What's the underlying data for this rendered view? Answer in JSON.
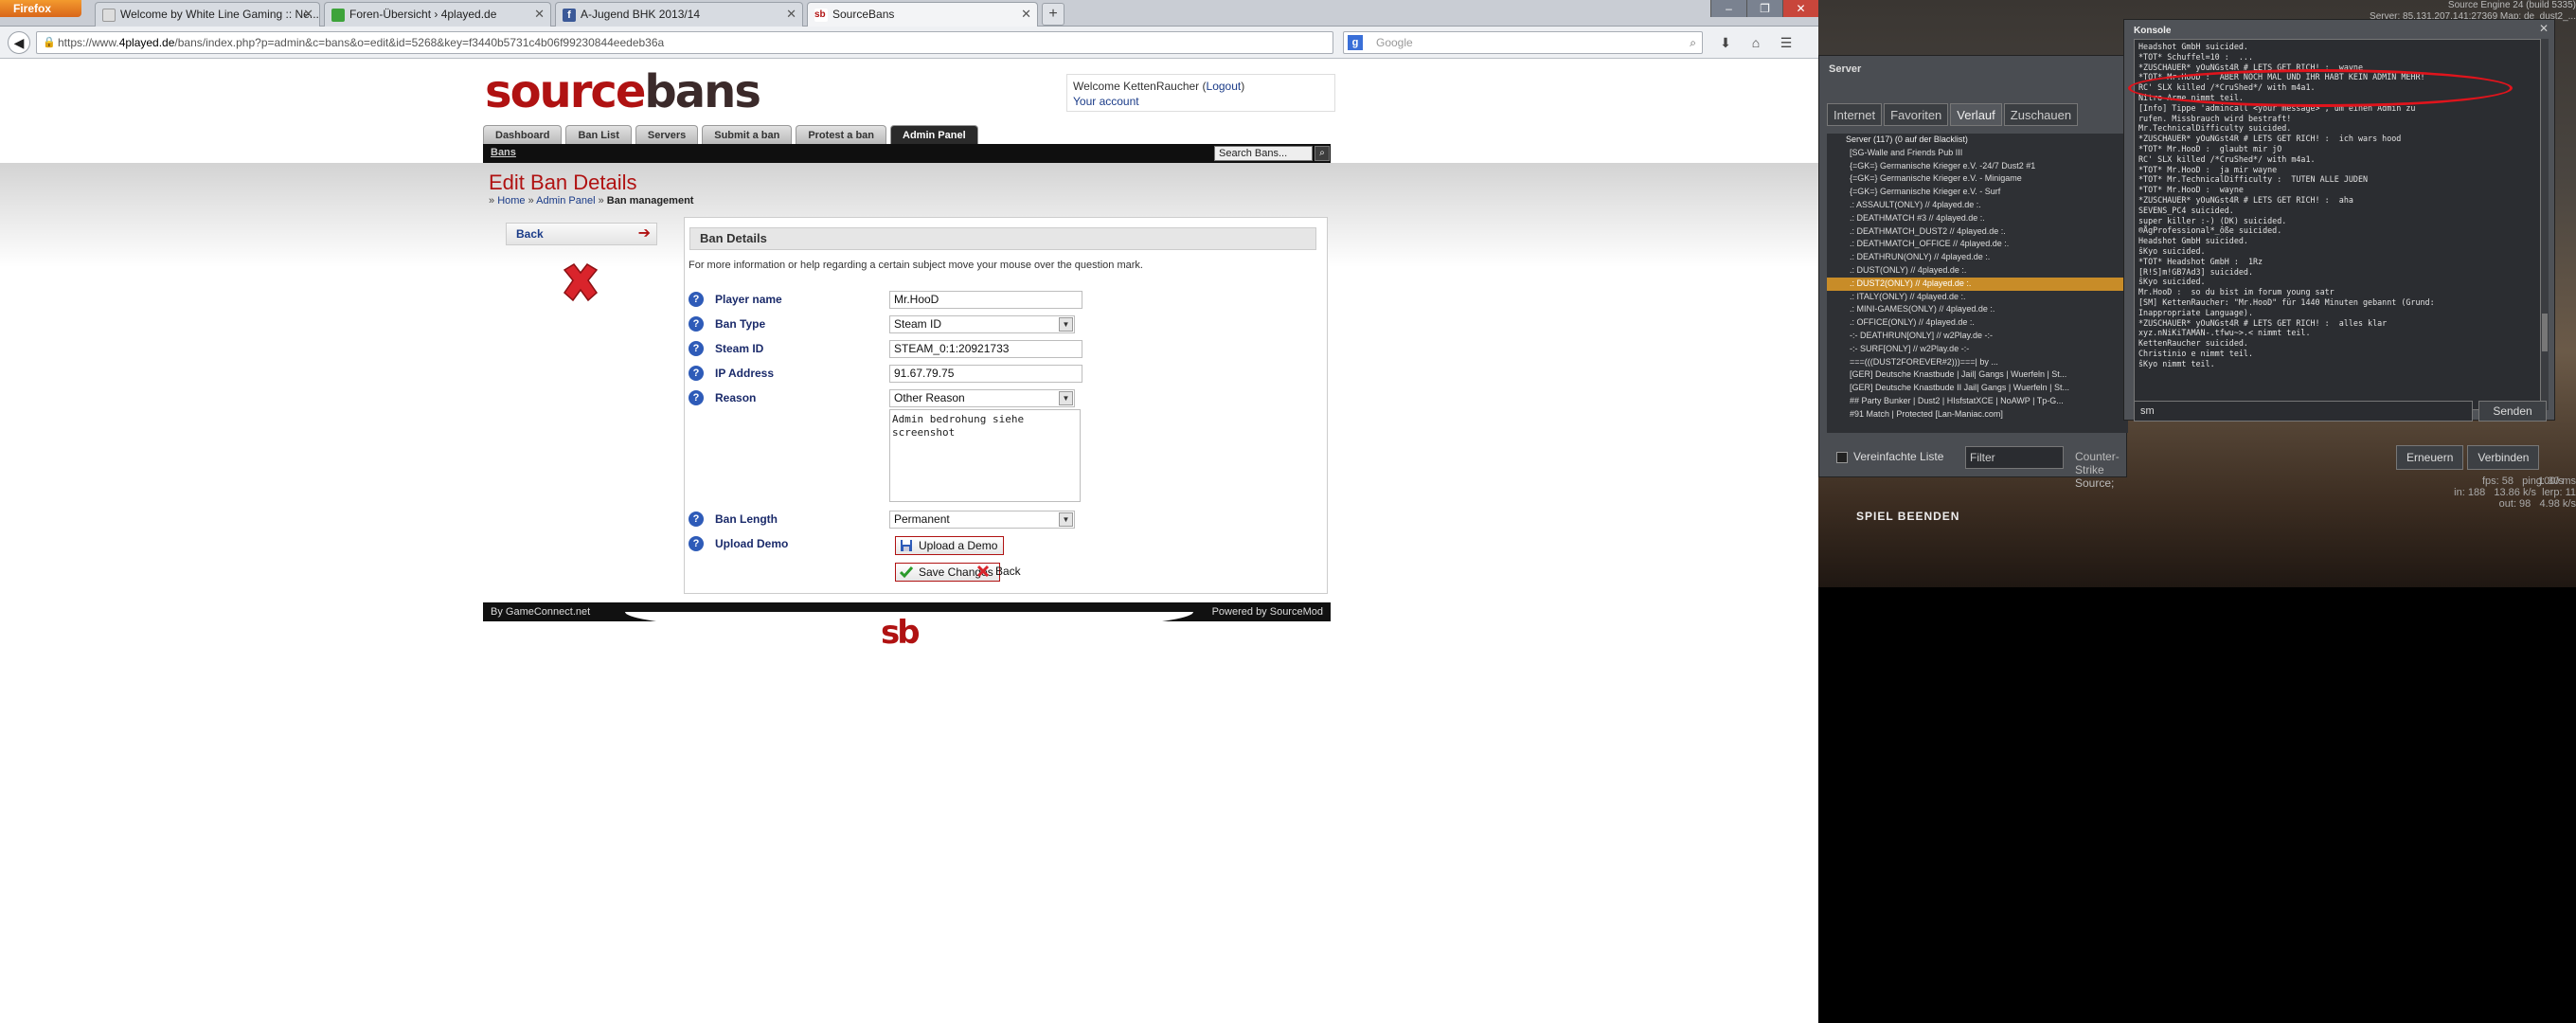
{
  "browser": {
    "menu_button": "Firefox",
    "tabs": [
      {
        "label": "Welcome by White Line Gaming :: Ne..."
      },
      {
        "label": "Foren-Übersicht › 4played.de"
      },
      {
        "label": "A-Jugend BHK 2013/14"
      },
      {
        "label": "SourceBans"
      }
    ],
    "new_tab": "+",
    "url_prefix": "https://www.",
    "url_domain": "4played.de",
    "url_rest": "/bans/index.php?p=admin&c=bans&o=edit&id=5268&key=f3440b5731c4b06f99230844eedeb36a",
    "search_placeholder": "Google",
    "window_controls": [
      "–",
      "❐",
      "✕"
    ]
  },
  "site": {
    "logo_left": "source",
    "logo_right": "bans",
    "user": {
      "welcome_prefix": "Welcome KettenRaucher (",
      "logout": "Logout",
      "welcome_suffix": ")",
      "account_link": "Your account"
    },
    "menu": [
      "Dashboard",
      "Ban List",
      "Servers",
      "Submit a ban",
      "Protest a ban",
      "Admin Panel"
    ],
    "sub_link": "Bans",
    "search_placeholder": "Search Bans...",
    "page_title": "Edit Ban Details",
    "breadcrumb": {
      "prefix": "» ",
      "home": "Home",
      "sep1": " » ",
      "admin": "Admin Panel",
      "sep2": " » ",
      "current": "Ban management"
    },
    "left_back": "Back",
    "card_title": "Ban Details",
    "card_note": "For more information or help regarding a certain subject move your mouse over the question mark.",
    "fields": {
      "player_name": {
        "label": "Player name",
        "value": "Mr.HooD"
      },
      "ban_type": {
        "label": "Ban Type",
        "value": "Steam ID"
      },
      "steam_id": {
        "label": "Steam ID",
        "value": "STEAM_0:1:20921733"
      },
      "ip_address": {
        "label": "IP Address",
        "value": "91.67.79.75"
      },
      "reason": {
        "label": "Reason",
        "value": "Other Reason",
        "text": "Admin bedrohung siehe\nscreenshot"
      },
      "ban_length": {
        "label": "Ban Length",
        "value": "Permanent"
      },
      "upload_demo": {
        "label": "Upload Demo",
        "button": "Upload a Demo"
      }
    },
    "save_button": "Save Changes",
    "back_button": "Back",
    "footer_left": "By GameConnect.net",
    "footer_right": "Powered by SourceMod",
    "footer_logo": "sb"
  },
  "game": {
    "hud_top": "Source Engine 24 (build 5335)\nServer: 85.131.207.141:27369 Map: de_dust2_...",
    "server_browser": {
      "title": "Server",
      "tabs": [
        "Internet",
        "Favoriten",
        "Verlauf",
        "Zuschauen"
      ],
      "header": "Server (117) (0 auf der Blacklist)",
      "rows": [
        "[SG-Walle and Friends Pub III",
        "{=GK=} Germanische Krieger e.V. -24/7 Dust2 #1",
        "{=GK=} Germanische Krieger e.V. - Minigame",
        "{=GK=} Germanische Krieger e.V. - Surf",
        ".: ASSAULT(ONLY) // 4played.de :.",
        ".: DEATHMATCH #3 // 4played.de :.",
        ".: DEATHMATCH_DUST2 // 4played.de :.",
        ".: DEATHMATCH_OFFICE // 4played.de :.",
        ".: DEATHRUN(ONLY) // 4played.de :.",
        ".: DUST(ONLY) // 4played.de :.",
        ".: DUST2(ONLY) // 4played.de :.",
        ".: ITALY(ONLY) // 4played.de :.",
        ".: MINI-GAMES(ONLY) // 4played.de :.",
        ".: OFFICE(ONLY) // 4played.de :.",
        "-:- DEATHRUN[ONLY] // w2Play.de -:-",
        "-:- SURF[ONLY] // w2Play.de -:-",
        "===(((DUST2FOREVER#2)))===| by ...",
        "[GER] Deutsche Knastbude | Jail| Gangs | Wuerfeln | St...",
        "[GER] Deutsche Knastbude II Jail| Gangs | Wuerfeln | St...",
        "## Party Bunker | Dust2 | HIsfstatXCE | NoAWP | Tp-G...",
        "#91 Match | Protected [Lan-Maniac.com]"
      ],
      "highlight_index": 10,
      "simple_list": "Vereinfachte Liste",
      "filter": "Filter",
      "game": "Counter-Strike Source;",
      "refresh": "Erneuern",
      "connect": "Verbinden"
    },
    "console": {
      "title": "Konsole",
      "close": "✕",
      "lines": [
        "Headshot GmbH suicided.",
        "*TOT* Schuffel=10 :  ...",
        "*ZUSCHAUER* yOuNGst4R # LETS GET RICH! :  wayne",
        "*TOT* Mr.HooD :  ABER NOCH MAL UND IHR HABT KEIN ADMIN MEHR!",
        "RC' SLX killed /*CruShed*/ with m4a1.",
        "Nitro Arme nimmt teil.",
        "[Info] Tippe 'admincall <your message>', um einen Admin zu",
        "rufen. Missbrauch wird bestraft!",
        "Mr.TechnicalDifficulty suicided.",
        "*ZUSCHAUER* yOuNGst4R # LETS GET RICH! :  ich wars hood",
        "*TOT* Mr.HooD :  glaubt mir jO",
        "RC' SLX killed /*CruShed*/ with m4a1.",
        "*TOT* Mr.HooD :  ja mir wayne",
        "*TOT* Mr.TechnicalDifficulty :  TUTEN ALLE JUDEN",
        "*TOT* Mr.HooD :  wayne",
        "*ZUSCHAUER* yOuNGst4R # LETS GET RICH! :  aha",
        "SEVENS_PC4 suicided.",
        "super killer :-) (DK) suicided.",
        "®ÅgProfessional*_ôße suicided.",
        "Headshot GmbH suicided.",
        "ŝKyo suicided.",
        "*TOT* Headshot GmbH :  1Rz",
        "[R!S]m!GB7Ad3] suicided.",
        "ŝKyo suicided.",
        "Mr.HooD :  so du bist im forum young satr",
        "[SM] KettenRaucher: \"Mr.HooD\" für 1440 Minuten gebannt (Grund:",
        "Inappropriate Language).",
        "*ZUSCHAUER* yOuNGst4R # LETS GET RICH! :  alles klar",
        "xyz.nNiKiTAMAN-.tfwu~>.< nimmt teil.",
        "KettenRaucher suicided.",
        "Christinio e nimmt teil.",
        "ŝKyo nimmt teil."
      ],
      "input": "sm",
      "send": "Senden"
    },
    "fps": "fps: 58   ping: 30 ms\nin: 188   13.86 k/s  lerp: 11\nout: 98   4.98 k/s",
    "rate": "100/s",
    "quit": "SPIEL BEENDEN"
  }
}
